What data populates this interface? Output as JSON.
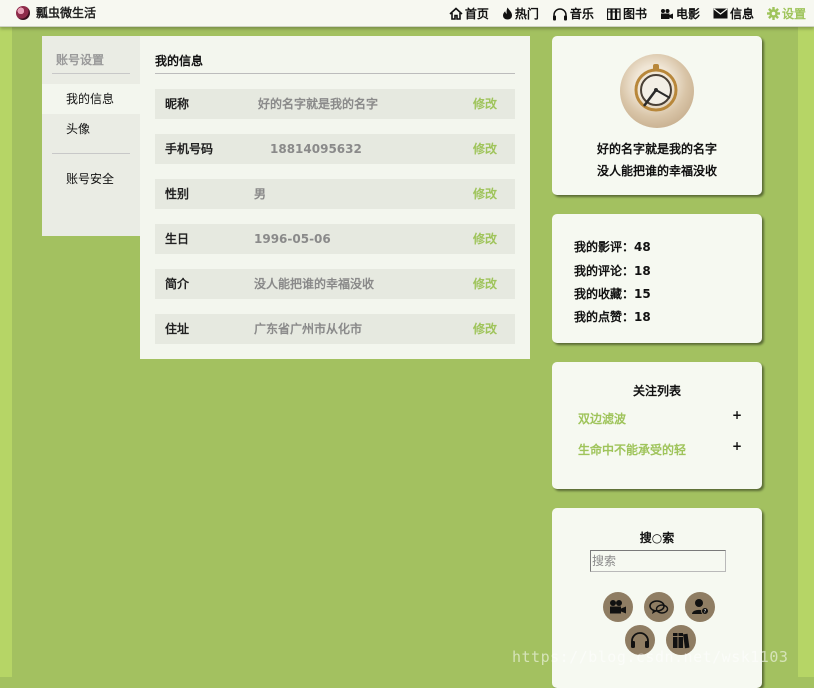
{
  "brand": {
    "name": "瓢虫微生活",
    "logo_icon": "ladybug-logo-icon"
  },
  "nav": [
    {
      "label": "首页",
      "icon": "home-icon"
    },
    {
      "label": "热门",
      "icon": "flame-icon"
    },
    {
      "label": "音乐",
      "icon": "headphones-icon"
    },
    {
      "label": "图书",
      "icon": "books-icon"
    },
    {
      "label": "电影",
      "icon": "video-camera-icon"
    },
    {
      "label": "信息",
      "icon": "envelope-icon"
    },
    {
      "label": "设置",
      "icon": "gear-icon",
      "active": true
    }
  ],
  "side": {
    "title": "账号设置",
    "items": [
      {
        "label": "我的信息",
        "active": true
      },
      {
        "label": "头像"
      },
      {
        "label": "账号安全"
      }
    ]
  },
  "main": {
    "title": "我的信息",
    "edit_label": "修改",
    "rows": [
      {
        "label": "昵称",
        "value": "好的名字就是我的名字"
      },
      {
        "label": "手机号码",
        "value": "18814095632"
      },
      {
        "label": "性别",
        "value": "男"
      },
      {
        "label": "生日",
        "value": "1996-05-06"
      },
      {
        "label": "简介",
        "value": "没人能把谁的幸福没收"
      },
      {
        "label": "住址",
        "value": "广东省广州市从化市"
      }
    ]
  },
  "profile": {
    "name": "好的名字就是我的名字",
    "bio": "没人能把谁的幸福没收"
  },
  "stats": [
    {
      "label": "我的影评：",
      "value": "48"
    },
    {
      "label": "我的评论：",
      "value": "18"
    },
    {
      "label": "我的收藏：",
      "value": "15"
    },
    {
      "label": "我的点赞：",
      "value": "18"
    }
  ],
  "follow": {
    "title": "关注列表",
    "plus": "+",
    "items": [
      "双边滤波",
      "生命中不能承受的轻"
    ]
  },
  "search": {
    "title": "搜○索",
    "placeholder": "搜索",
    "value": "",
    "icons": [
      "video-camera-icon",
      "chat-bubbles-icon",
      "user-help-icon",
      "headphones-icon",
      "books-icon"
    ]
  },
  "watermark": "https://blog.csdn.net/wsk1103",
  "colors": {
    "background": "#a3c160",
    "accent": "#9fc45b",
    "panel": "#f3f6ee",
    "row": "#e6e9e0"
  }
}
